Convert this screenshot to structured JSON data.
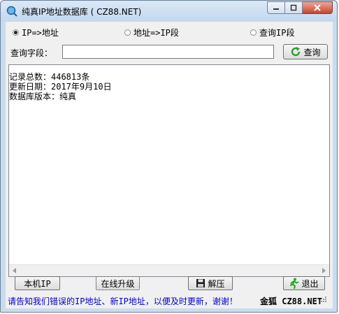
{
  "window": {
    "title": "纯真IP地址数据库 ( CZ88.NET)",
    "controls": [
      "minimize",
      "maximize",
      "close"
    ]
  },
  "mode": {
    "options": [
      {
        "label": "IP=>地址",
        "selected": true
      },
      {
        "label": "地址=>IP段",
        "selected": false
      },
      {
        "label": "查询IP段",
        "selected": false
      }
    ]
  },
  "search": {
    "label": "查询字段：",
    "value": "",
    "button_label": "查询",
    "button_icon": "refresh-icon"
  },
  "result": {
    "lines": [
      "记录总数：446813条",
      "更新日期：2017年9月10日",
      "数据库版本：纯真"
    ]
  },
  "buttons": {
    "local_ip": "本机IP",
    "upgrade": "在线升级",
    "extract": "解压",
    "extract_icon": "floppy-disk-icon",
    "exit": "退出",
    "exit_icon": "running-man-icon"
  },
  "status": {
    "message": "请告知我们错误的IP地址、新IP地址，以便及时更新，谢谢！",
    "author": "金狐 CZ88.NET"
  },
  "colors": {
    "title_bar": "#c3d7ee",
    "close_button": "#c8442d",
    "status_text": "#0000cc",
    "exit_icon": "#22aa22",
    "refresh_icon": "#2e9e2e"
  }
}
